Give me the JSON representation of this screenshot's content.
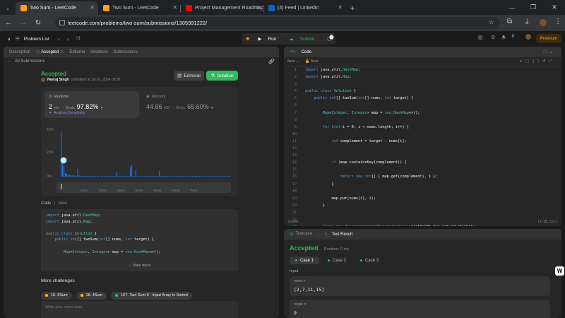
{
  "browser": {
    "tabs": [
      {
        "title": "Two Sum - LeetCode",
        "active": true,
        "favicon_color": "#ffa116"
      },
      {
        "title": "Two Sum - LeetCode",
        "active": false,
        "favicon_color": "#ffa116"
      },
      {
        "title": "Project Management Roadmap",
        "active": false,
        "favicon_color": "#ff0000"
      },
      {
        "title": "(4) Feed | LinkedIn",
        "active": false,
        "favicon_color": "#0a66c2"
      }
    ],
    "url": "leetcode.com/problems/two-sum/submissions/1305991222/"
  },
  "lc_nav": {
    "problem_list": "Problem List",
    "run": "Run",
    "submit": "Submit",
    "coins": "0",
    "premium": "Premium"
  },
  "left_tabs": [
    "Description",
    "Accepted",
    "Editorial",
    "Solutions",
    "Submissions"
  ],
  "all_submissions": "All Submissions",
  "submission": {
    "status": "Accepted",
    "user": "Neeraj Singh",
    "submitted_at": "submitted at Jul 01, 2024 09:38",
    "editorial_btn": "Editorial",
    "solution_btn": "Solution",
    "runtime_label": "Runtime",
    "runtime_value": "2",
    "runtime_unit": "ms",
    "beats_label": "Beats",
    "runtime_beats": "97.82%",
    "analyze": "Analyze Complexity",
    "memory_label": "Memory",
    "memory_value": "44.66",
    "memory_unit": "MB",
    "memory_beats": "65.60%"
  },
  "chart_data": {
    "type": "bar",
    "y_ticks": [
      "40%",
      "20%",
      "0%"
    ],
    "x_ticks": [
      "11ms",
      "22ms",
      "33ms",
      "44ms",
      "54ms",
      "65ms",
      "76ms"
    ],
    "ylim": [
      0,
      45
    ],
    "values": [
      38,
      14,
      9,
      3,
      2.5,
      2,
      1.5,
      1.2,
      1,
      1,
      0.9,
      0.8,
      7,
      1,
      0.7,
      0.7,
      0.6,
      0.6,
      0.6,
      0.5,
      0.5,
      0.5,
      0.5,
      0.5,
      0.5,
      0.5,
      0.5,
      0.5,
      0.5,
      0.5,
      0.5,
      0.5,
      0.5,
      0.5,
      0.5,
      0.5,
      0.5,
      0.5,
      0.5,
      0.5,
      4,
      0.5,
      0.5,
      0.5,
      0.5,
      0.5,
      0.5,
      0.5,
      0.5,
      0.5,
      8,
      10,
      0.5,
      0.5,
      6,
      0.5,
      0.5,
      0.5,
      0.5,
      0.5,
      0.5,
      0.5,
      0.5,
      0.5,
      0.5,
      0.5,
      0.5,
      0.5,
      0.5,
      0.5,
      0.5,
      5,
      0.5,
      0.5,
      0.5,
      0.5,
      0.5,
      0.5,
      0.5,
      0.5,
      0.5,
      0.5,
      0.5,
      0.5,
      0.5,
      0.5,
      0.5,
      0.5,
      0.5,
      0.5,
      0.5,
      0.5,
      0.5,
      0.5,
      0.5,
      0.5,
      0.5,
      0.5,
      0.5,
      0.5,
      0.5,
      0.5,
      0.5,
      0.5,
      0.5,
      0.5,
      0.5,
      0.5,
      0.5,
      0.5,
      0.5,
      0.5,
      0.5,
      0.5,
      0.5,
      0.5,
      0.5,
      0.5,
      0.5,
      0.5,
      0.5,
      0.5,
      0.5
    ],
    "highlight_index": 1,
    "bar_color": "#1a73e8"
  },
  "code_section": {
    "label": "Code",
    "lang": "Java",
    "view_more": "View more",
    "preview": [
      "import java.util.HashMap;",
      "import java.util.Map;",
      "",
      "public class Solution {",
      "    public int[] twoSum(int[] nums, int target) {",
      "",
      "        Map<Integer, Integer> map = new HashMap<>();"
    ]
  },
  "more_challenges": {
    "title": "More challenges",
    "items": [
      "15. 3Sum",
      "18. 4Sum",
      "167. Two Sum II - Input Array Is Sorted"
    ]
  },
  "notes_placeholder": "Write your notes here",
  "editor": {
    "title": "Code",
    "lang": "Java",
    "auto": "Auto",
    "lines": [
      "import java.util.HashMap;",
      "import java.util.Map;",
      "",
      "public class Solution {",
      "    public int[] twoSum(int[] nums, int target) {",
      "",
      "        Map<Integer, Integer> map = new HashMap<>();",
      "",
      "        for (int i = 0; i < nums.length; i++) {",
      "",
      "            int complement = target - nums[i];",
      "",
      "",
      "            if (map.containsKey(complement)) {",
      "",
      "                return new int[] { map.get(complement), i };",
      "            }",
      "",
      "            map.put(nums[i], i);",
      "        }",
      "",
      "",
      "        throw new IllegalArgumentException(\"No two sum solution\");",
      "    }",
      "}",
      ""
    ],
    "status_left": "Saved",
    "status_right": "Ln 18, Col 1"
  },
  "testcase": {
    "tab_testcase": "Testcase",
    "tab_result": "Test Result",
    "status": "Accepted",
    "runtime": "Runtime: 0 ms",
    "cases": [
      "Case 1",
      "Case 2",
      "Case 3"
    ],
    "input_label": "Input",
    "param1_name": "nums =",
    "param1_value": "[2,7,11,15]",
    "param2_name": "target =",
    "param2_value": "9"
  }
}
